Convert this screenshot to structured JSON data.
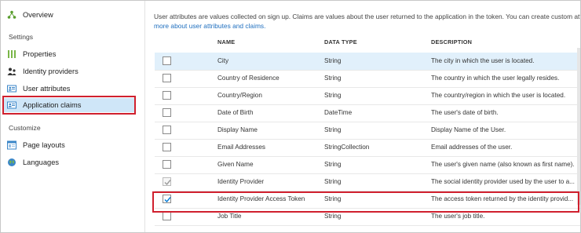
{
  "sidebar": {
    "items": [
      {
        "label": "Overview",
        "icon": "overview-icon"
      },
      {
        "label": "Properties",
        "icon": "properties-icon"
      },
      {
        "label": "Identity providers",
        "icon": "identity-providers-icon"
      },
      {
        "label": "User attributes",
        "icon": "user-attributes-icon"
      },
      {
        "label": "Application claims",
        "icon": "application-claims-icon"
      },
      {
        "label": "Page layouts",
        "icon": "page-layouts-icon"
      },
      {
        "label": "Languages",
        "icon": "languages-icon"
      }
    ],
    "sections": {
      "settings": "Settings",
      "customize": "Customize"
    }
  },
  "main": {
    "intro_text": "User attributes are values collected on sign up. Claims are values about the user returned to the application in the token. You can create custom attri",
    "intro_link": "more about user attributes and claims.",
    "columns": [
      "NAME",
      "DATA TYPE",
      "DESCRIPTION"
    ],
    "rows": [
      {
        "name": "City",
        "type": "String",
        "desc": "The city in which the user is located.",
        "state": "unchecked"
      },
      {
        "name": "Country of Residence",
        "type": "String",
        "desc": "The country in which the user legally resides.",
        "state": "unchecked"
      },
      {
        "name": "Country/Region",
        "type": "String",
        "desc": "The country/region in which the user is located.",
        "state": "unchecked"
      },
      {
        "name": "Date of Birth",
        "type": "DateTime",
        "desc": "The user's date of birth.",
        "state": "unchecked"
      },
      {
        "name": "Display Name",
        "type": "String",
        "desc": "Display Name of the User.",
        "state": "unchecked"
      },
      {
        "name": "Email Addresses",
        "type": "StringCollection",
        "desc": "Email addresses of the user.",
        "state": "unchecked"
      },
      {
        "name": "Given Name",
        "type": "String",
        "desc": "The user's given name (also known as first name).",
        "state": "unchecked"
      },
      {
        "name": "Identity Provider",
        "type": "String",
        "desc": "The social identity provider used by the user to a...",
        "state": "disabled-checked"
      },
      {
        "name": "Identity Provider Access Token",
        "type": "String",
        "desc": "The access token returned by the identity provid...",
        "state": "checked"
      },
      {
        "name": "Job Title",
        "type": "String",
        "desc": "The user's job title.",
        "state": "unchecked"
      }
    ]
  },
  "colors": {
    "accent": "#0078d4",
    "highlight": "#d0202e",
    "selected_bg": "#cfe6f8",
    "link": "#1f6fbf"
  }
}
